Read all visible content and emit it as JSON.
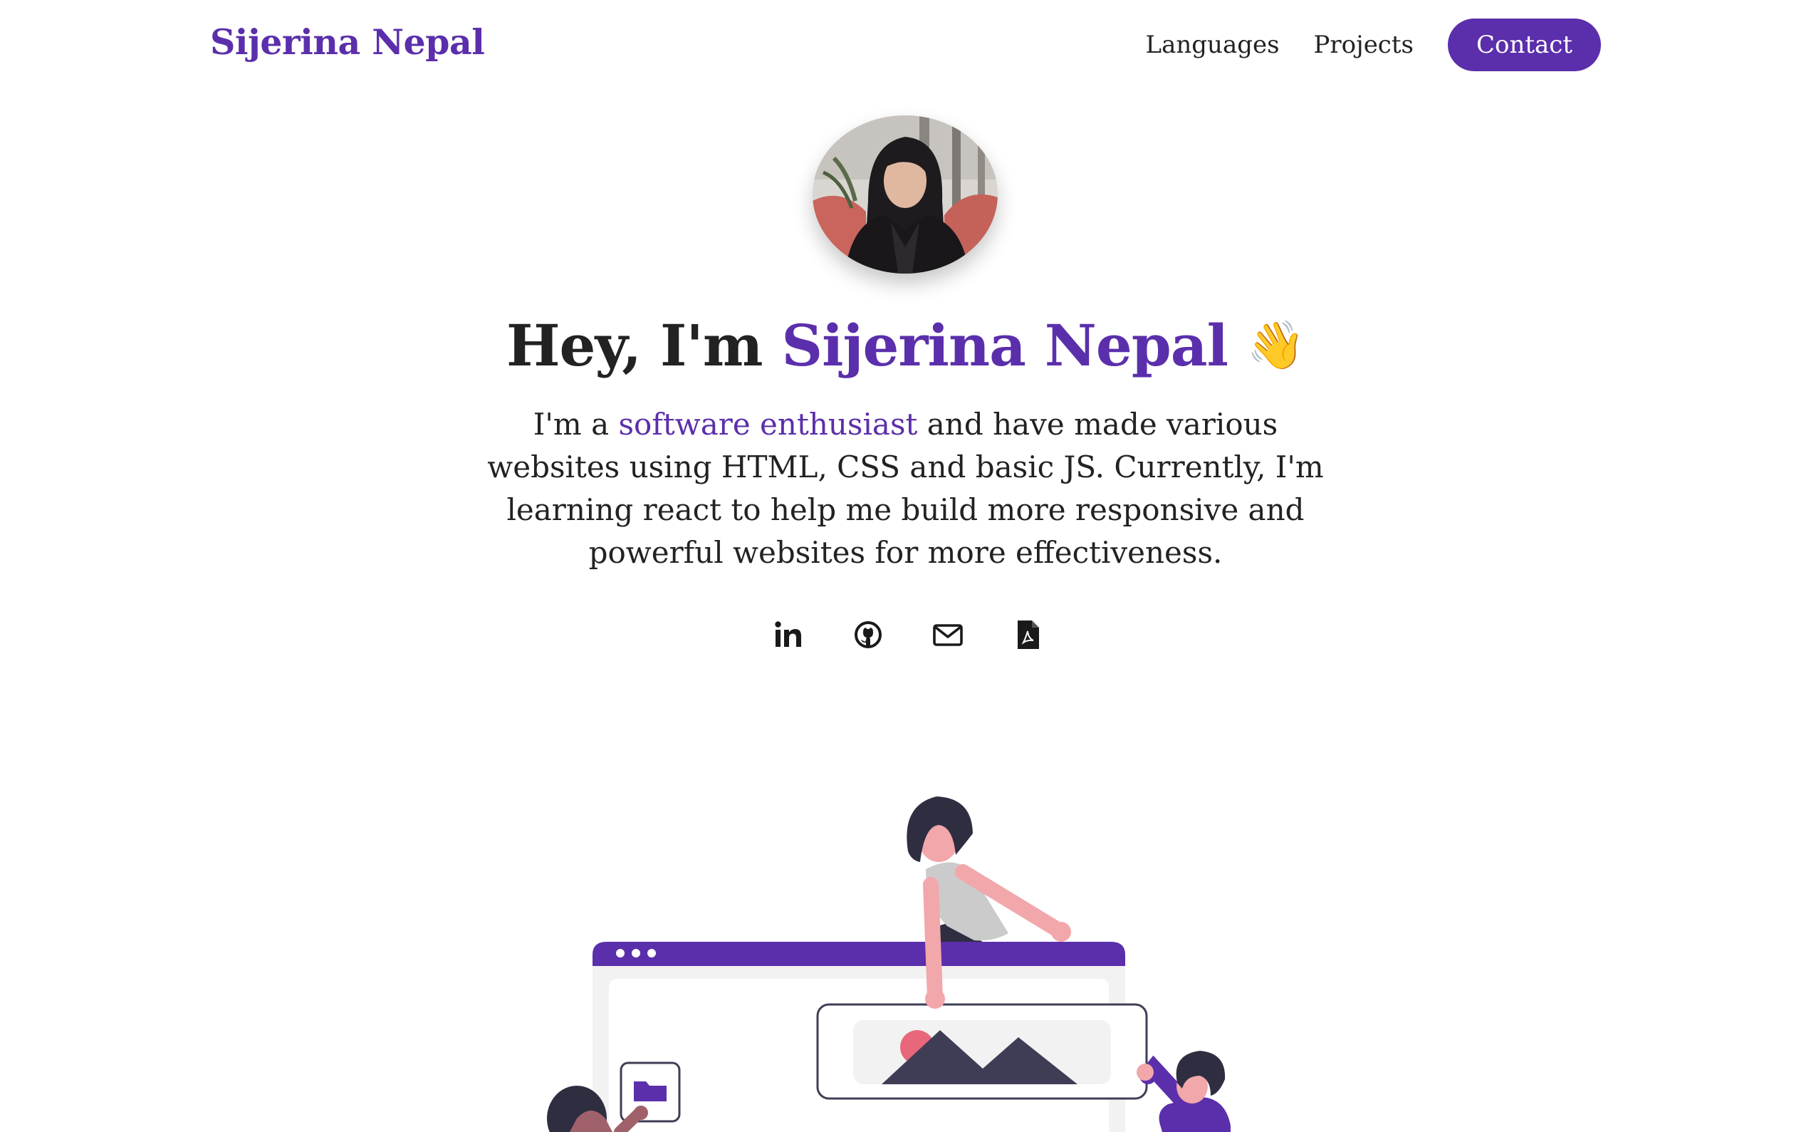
{
  "header": {
    "brand": "Sijerina Nepal",
    "nav": {
      "languages": "Languages",
      "projects": "Projects",
      "contact": "Contact"
    }
  },
  "hero": {
    "avatar_alt": "Sijerina Nepal profile photo",
    "headline_prefix": "Hey, I'm ",
    "headline_name": "Sijerina Nepal",
    "headline_emoji": "👋",
    "intro_prefix": "I'm a ",
    "intro_highlight": "software enthusiast",
    "intro_suffix": " and have made various websites using HTML, CSS and basic JS. Currently, I'm learning react to help me build more responsive and powerful websites for more effectiveness."
  },
  "socials": [
    {
      "icon": "linkedin-icon"
    },
    {
      "icon": "github-icon"
    },
    {
      "icon": "mail-icon"
    },
    {
      "icon": "pdf-icon"
    }
  ],
  "colors": {
    "accent": "#5b2fab",
    "text": "#222222",
    "background": "#ffffff",
    "illustration_dark": "#3f3d56",
    "illustration_pink": "#e8677b"
  }
}
